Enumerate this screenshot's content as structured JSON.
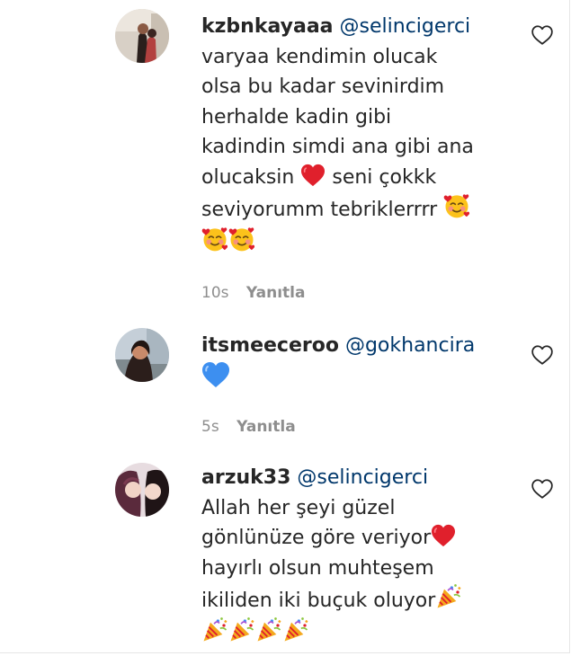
{
  "comments": [
    {
      "username": "kzbnkayaaa",
      "mention": "@selincigerci",
      "text_lines": [
        "varyaa kendimin olucak",
        "olsa bu kadar sevinirdim",
        "herhalde kadin gibi",
        "kadindin simdi ana gibi ana"
      ],
      "text_line5_before": "olucaksin",
      "text_line5_after": "seni çokkk",
      "text_line6": "seviyorumm tebriklerrrr",
      "time": "10s",
      "reply_label": "Yanıtla",
      "like_icon": "heart-outline-icon",
      "emojis": [
        "red-heart-emoji",
        "smiling-face-with-hearts-emoji"
      ]
    },
    {
      "username": "itsmeeceroo",
      "mention": "@gokhancira",
      "time": "5s",
      "reply_label": "Yanıtla",
      "like_icon": "heart-outline-icon",
      "emojis": [
        "blue-heart-emoji"
      ]
    },
    {
      "username": "arzuk33",
      "mention": "@selincigerci",
      "text_lines": [
        "Allah her şeyi güzel",
        "gönlünüze göre veriyor",
        "hayırlı olsun muhteşem",
        "ikiliden iki buçuk oluyor"
      ],
      "like_icon": "heart-outline-icon",
      "emojis": [
        "red-heart-emoji",
        "party-popper-emoji"
      ]
    }
  ],
  "colors": {
    "text": "#262626",
    "mention": "#00376b",
    "meta": "#8e8e8e",
    "red_heart": "#e0202c",
    "blue_heart": "#3d8ff0"
  }
}
